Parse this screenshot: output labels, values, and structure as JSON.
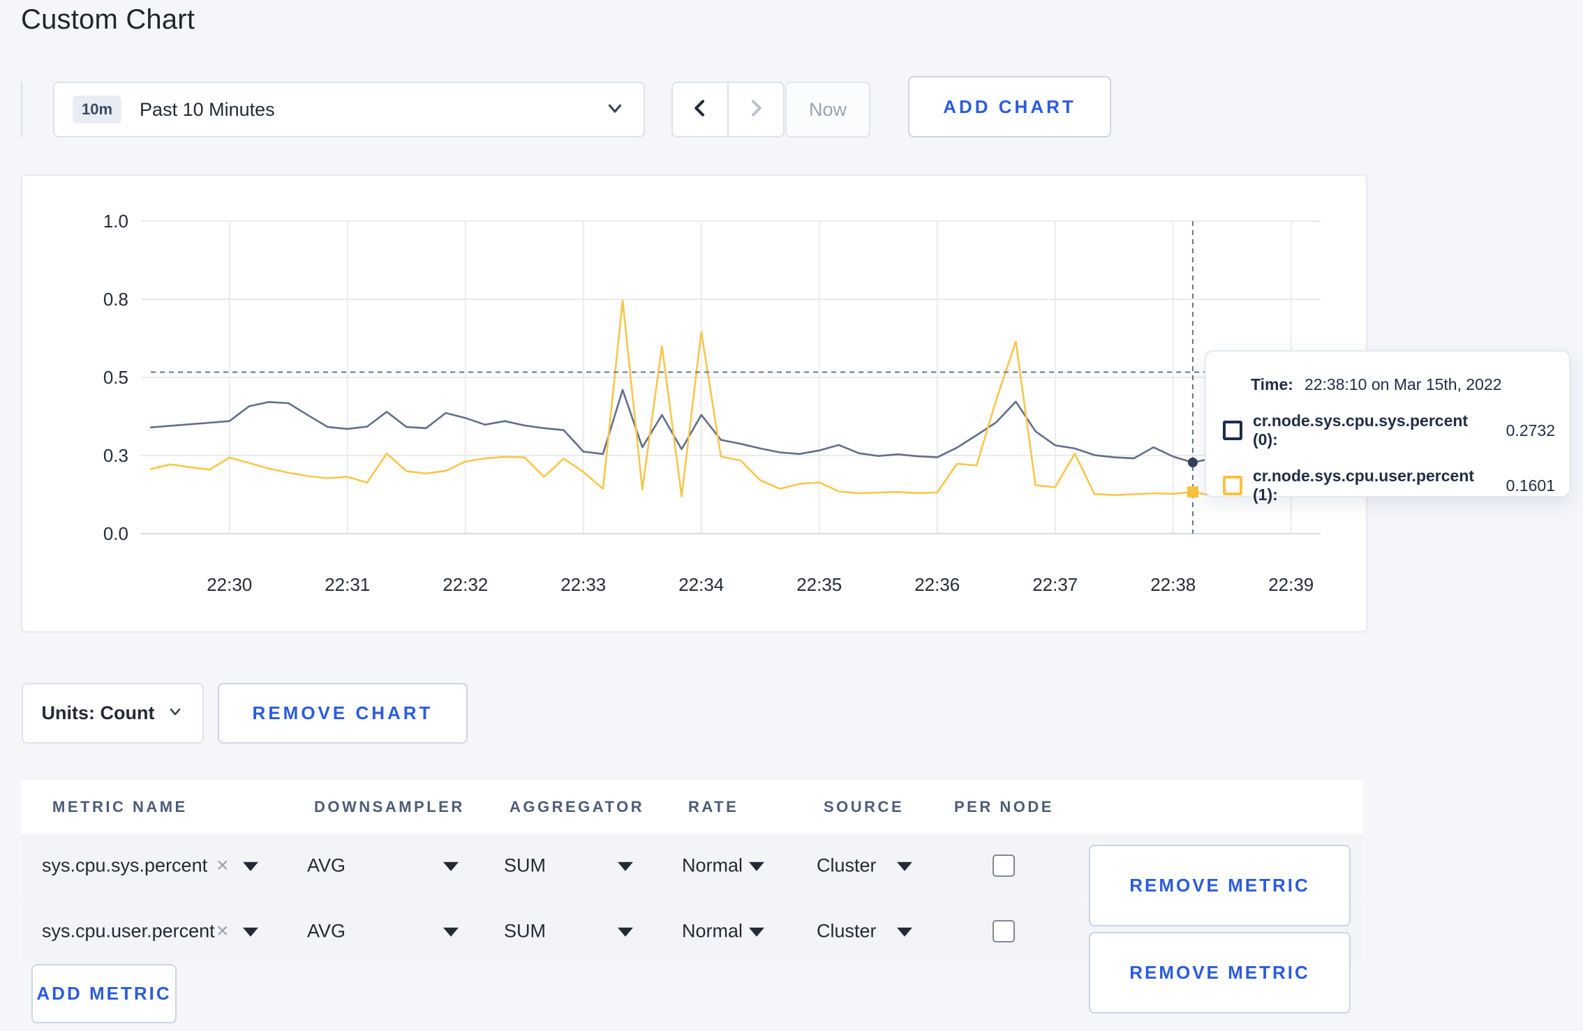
{
  "page": {
    "title": "Custom Chart"
  },
  "colors": {
    "accent_blue": "#2a5be0",
    "series_sys": "#5f6e8c",
    "series_user": "#f9c64a",
    "crosshair": "#5c7590"
  },
  "toolbar": {
    "time_badge": "10m",
    "time_label": "Past 10 Minutes",
    "now_label": "Now",
    "add_chart_label": "ADD CHART"
  },
  "chart_data": {
    "type": "line",
    "title": "",
    "xlabel": "",
    "ylabel": "",
    "grid": true,
    "legend_position": "none",
    "x_start": "22:29:20",
    "x_step_seconds": 10,
    "x_domain": [
      "22:29:15",
      "22:39:15"
    ],
    "x_ticks": [
      "22:30",
      "22:31",
      "22:32",
      "22:33",
      "22:34",
      "22:35",
      "22:36",
      "22:37",
      "22:38",
      "22:39"
    ],
    "y_tick_values": [
      0,
      0.3,
      0.5,
      0.8,
      1.0
    ],
    "y_tick_labels": [
      "0.0",
      "0.3",
      "0.5",
      "0.8",
      "1.0"
    ],
    "ylim": [
      0,
      1.0
    ],
    "crosshair": {
      "time": "22:38:10",
      "y_value": 0.52
    },
    "series": [
      {
        "name": "cr.node.sys.cpu.sys.percent",
        "color": "#5f6e8c",
        "marker": "circle",
        "marker_color": "#33425f",
        "values": [
          0.372,
          0.376,
          0.38,
          0.384,
          0.388,
          0.426,
          0.437,
          0.434,
          0.403,
          0.373,
          0.368,
          0.374,
          0.412,
          0.373,
          0.37,
          0.409,
          0.396,
          0.379,
          0.388,
          0.377,
          0.37,
          0.365,
          0.31,
          0.304,
          0.468,
          0.321,
          0.404,
          0.316,
          0.404,
          0.34,
          0.33,
          0.318,
          0.308,
          0.304,
          0.313,
          0.327,
          0.306,
          0.298,
          0.303,
          0.297,
          0.293,
          0.32,
          0.352,
          0.385,
          0.438,
          0.362,
          0.326,
          0.318,
          0.301,
          0.293,
          0.289,
          0.321,
          0.296,
          0.2732,
          0.289,
          0.311,
          0.301,
          0.296,
          0.297,
          0.309
        ]
      },
      {
        "name": "cr.node.sys.cpu.user.percent",
        "color": "#f9c64a",
        "marker": "square",
        "marker_color": "#fcc13c",
        "values": [
          0.248,
          0.266,
          0.255,
          0.246,
          0.292,
          0.271,
          0.25,
          0.234,
          0.221,
          0.213,
          0.218,
          0.196,
          0.305,
          0.24,
          0.231,
          0.241,
          0.277,
          0.289,
          0.295,
          0.293,
          0.218,
          0.288,
          0.237,
          0.172,
          0.795,
          0.17,
          0.62,
          0.143,
          0.675,
          0.296,
          0.281,
          0.205,
          0.172,
          0.191,
          0.197,
          0.162,
          0.155,
          0.158,
          0.16,
          0.156,
          0.158,
          0.268,
          0.262,
          0.442,
          0.638,
          0.186,
          0.178,
          0.305,
          0.152,
          0.148,
          0.151,
          0.155,
          0.153,
          0.1601,
          0.146,
          0.142,
          0.22,
          0.298,
          0.268,
          0.246
        ]
      }
    ]
  },
  "tooltip": {
    "time_label": "Time:",
    "time_value": "22:38:10 on Mar 15th, 2022",
    "entries": [
      {
        "name": "cr.node.sys.cpu.sys.percent (0):",
        "value": "0.2732",
        "color": "#1c2b4a"
      },
      {
        "name": "cr.node.sys.cpu.user.percent (1):",
        "value": "0.1601",
        "color": "#fcc13c"
      }
    ]
  },
  "controls": {
    "units_label": "Units: Count",
    "remove_chart_label": "REMOVE CHART",
    "remove_metric_label": "REMOVE METRIC",
    "add_metric_label": "ADD METRIC"
  },
  "metrics_table": {
    "clear_symbol": "×",
    "headers": [
      "METRIC NAME",
      "DOWNSAMPLER",
      "AGGREGATOR",
      "RATE",
      "SOURCE",
      "PER NODE"
    ],
    "rows": [
      {
        "metric": "sys.cpu.sys.percent",
        "downsampler": "AVG",
        "aggregator": "SUM",
        "rate": "Normal",
        "source": "Cluster",
        "per_node_checked": false
      },
      {
        "metric": "sys.cpu.user.percent",
        "downsampler": "AVG",
        "aggregator": "SUM",
        "rate": "Normal",
        "source": "Cluster",
        "per_node_checked": false
      }
    ]
  }
}
